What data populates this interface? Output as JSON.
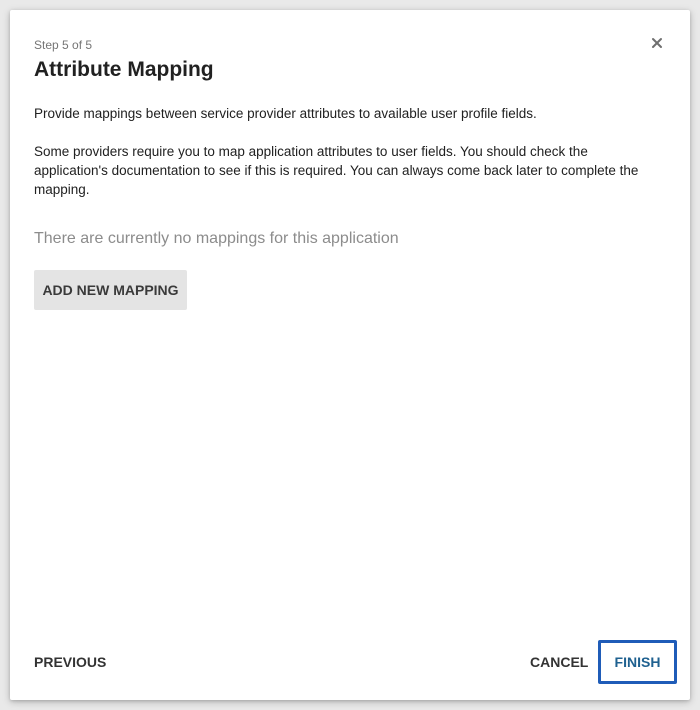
{
  "dialog": {
    "step": "Step 5 of 5",
    "title": "Attribute Mapping",
    "description_primary": "Provide mappings between service provider attributes to available user profile fields.",
    "description_secondary": "Some providers require you to map application attributes to user fields. You should check the application's documentation to see if this is required. You can always come back later to complete the mapping.",
    "empty_state": "There are currently no mappings for this application",
    "add_button_label": "ADD NEW MAPPING",
    "close_icon": "close-icon"
  },
  "footer": {
    "previous_label": "PREVIOUS",
    "cancel_label": "CANCEL",
    "finish_label": "FINISH"
  },
  "colors": {
    "primary_button_text": "#1f6190",
    "focus_outline": "#1f5cb8",
    "secondary_button_bg": "#e4e4e4"
  }
}
